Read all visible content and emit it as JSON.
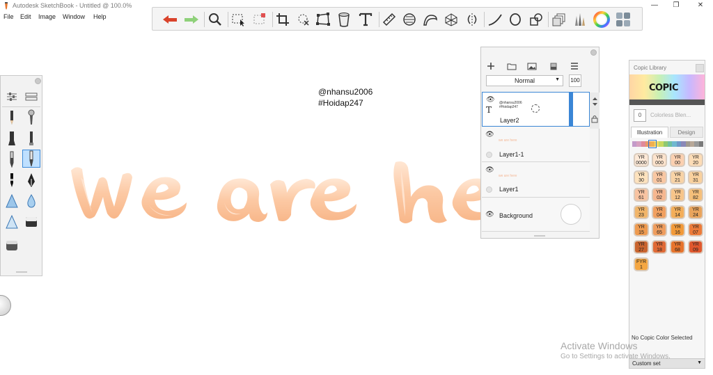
{
  "window": {
    "title": "Autodesk SketchBook - Untitled @ 100.0%",
    "minimize": "—",
    "maximize": "❐",
    "close": "✕"
  },
  "menu": [
    "File",
    "Edit",
    "Image",
    "Window",
    "Help"
  ],
  "toolbar": {
    "tools": [
      "undo-icon",
      "redo-icon",
      "zoom-icon",
      "select-icon",
      "select-transform-icon",
      "crop-icon",
      "lasso-select-icon",
      "distort-icon",
      "bucket-icon",
      "text-icon",
      "ruler-icon",
      "ellipse-guide-icon",
      "french-curve-icon",
      "perspective-icon",
      "symmetry-icon",
      "stroke-icon",
      "ellipse-icon",
      "shape-icon",
      "layers-icon",
      "brushes-icon",
      "color-wheel-icon",
      "copic-icon"
    ]
  },
  "canvas": {
    "handle": "@nhansu2006",
    "tag": "#Hoidap247",
    "lettering_colors": [
      "#ffd3b4",
      "#f7b68c",
      "#ffe4cf"
    ]
  },
  "layers": {
    "blend_mode": "Normal",
    "opacity": "100",
    "items": [
      {
        "name": "Layer2",
        "thumb_lines": [
          "@nhansu2006",
          "#Hoidap247"
        ],
        "selected": true,
        "has_text": true
      },
      {
        "name": "Layer1-1",
        "thumb_lines": [
          "we are here"
        ],
        "selected": false,
        "has_text": false
      },
      {
        "name": "Layer1",
        "thumb_lines": [
          "we are here"
        ],
        "selected": false,
        "has_text": false
      },
      {
        "name": "Background",
        "thumb_lines": [],
        "selected": false,
        "has_text": false
      }
    ]
  },
  "copic": {
    "title": "Copic Library",
    "logo": "COPIC",
    "selected_value": "0",
    "selected_name": "Colorless Blen...",
    "tab_illustration": "Illustration",
    "tab_design": "Design",
    "hue_colors": [
      "#c39ac9",
      "#d6a0c0",
      "#e08a9a",
      "#e89a6a",
      "#f0b050",
      "#f5d860",
      "#c8d860",
      "#90c870",
      "#70c0a0",
      "#70b8d0",
      "#7098c8",
      "#8a88b8",
      "#a09a90",
      "#b8a898",
      "#9a9a9a",
      "#7a7a7a"
    ],
    "swatches": [
      {
        "code": "YR\n0000",
        "color": "#fde9d7"
      },
      {
        "code": "YR\n000",
        "color": "#fde3cc"
      },
      {
        "code": "YR\n00",
        "color": "#fbd0b0"
      },
      {
        "code": "YR\n20",
        "color": "#fcdcb6"
      },
      {
        "code": "YR\n30",
        "color": "#fde2bd"
      },
      {
        "code": "YR\n01",
        "color": "#f9c7a2"
      },
      {
        "code": "YR\n21",
        "color": "#f8d3a6"
      },
      {
        "code": "YR\n31",
        "color": "#f9d19e"
      },
      {
        "code": "YR\n61",
        "color": "#f8c3a1"
      },
      {
        "code": "YR\n02",
        "color": "#f6b790"
      },
      {
        "code": "YR\n12",
        "color": "#f7c58a"
      },
      {
        "code": "YR\n82",
        "color": "#f5bf7a"
      },
      {
        "code": "YR\n23",
        "color": "#f1b56a"
      },
      {
        "code": "YR\n04",
        "color": "#f1a060"
      },
      {
        "code": "YR\n14",
        "color": "#f3ae5a"
      },
      {
        "code": "YR\n24",
        "color": "#e9a45c"
      },
      {
        "code": "YR\n15",
        "color": "#ee9a4f"
      },
      {
        "code": "YR\n65",
        "color": "#ef9d5e"
      },
      {
        "code": "YR\n16",
        "color": "#f29a3a"
      },
      {
        "code": "YR\n07",
        "color": "#ec7b3a"
      },
      {
        "code": "YR\n27",
        "color": "#c9642e"
      },
      {
        "code": "YR\n18",
        "color": "#e06a36"
      },
      {
        "code": "YR\n68",
        "color": "#e7742d"
      },
      {
        "code": "YR\n09",
        "color": "#e0582d"
      },
      {
        "code": "FYR\n1",
        "color": "#f5a742"
      }
    ],
    "status": "No Copic Color Selected",
    "custom_set": "Custom set"
  },
  "watermark": {
    "line1": "Activate Windows",
    "line2": "Go to Settings to activate Windows."
  }
}
